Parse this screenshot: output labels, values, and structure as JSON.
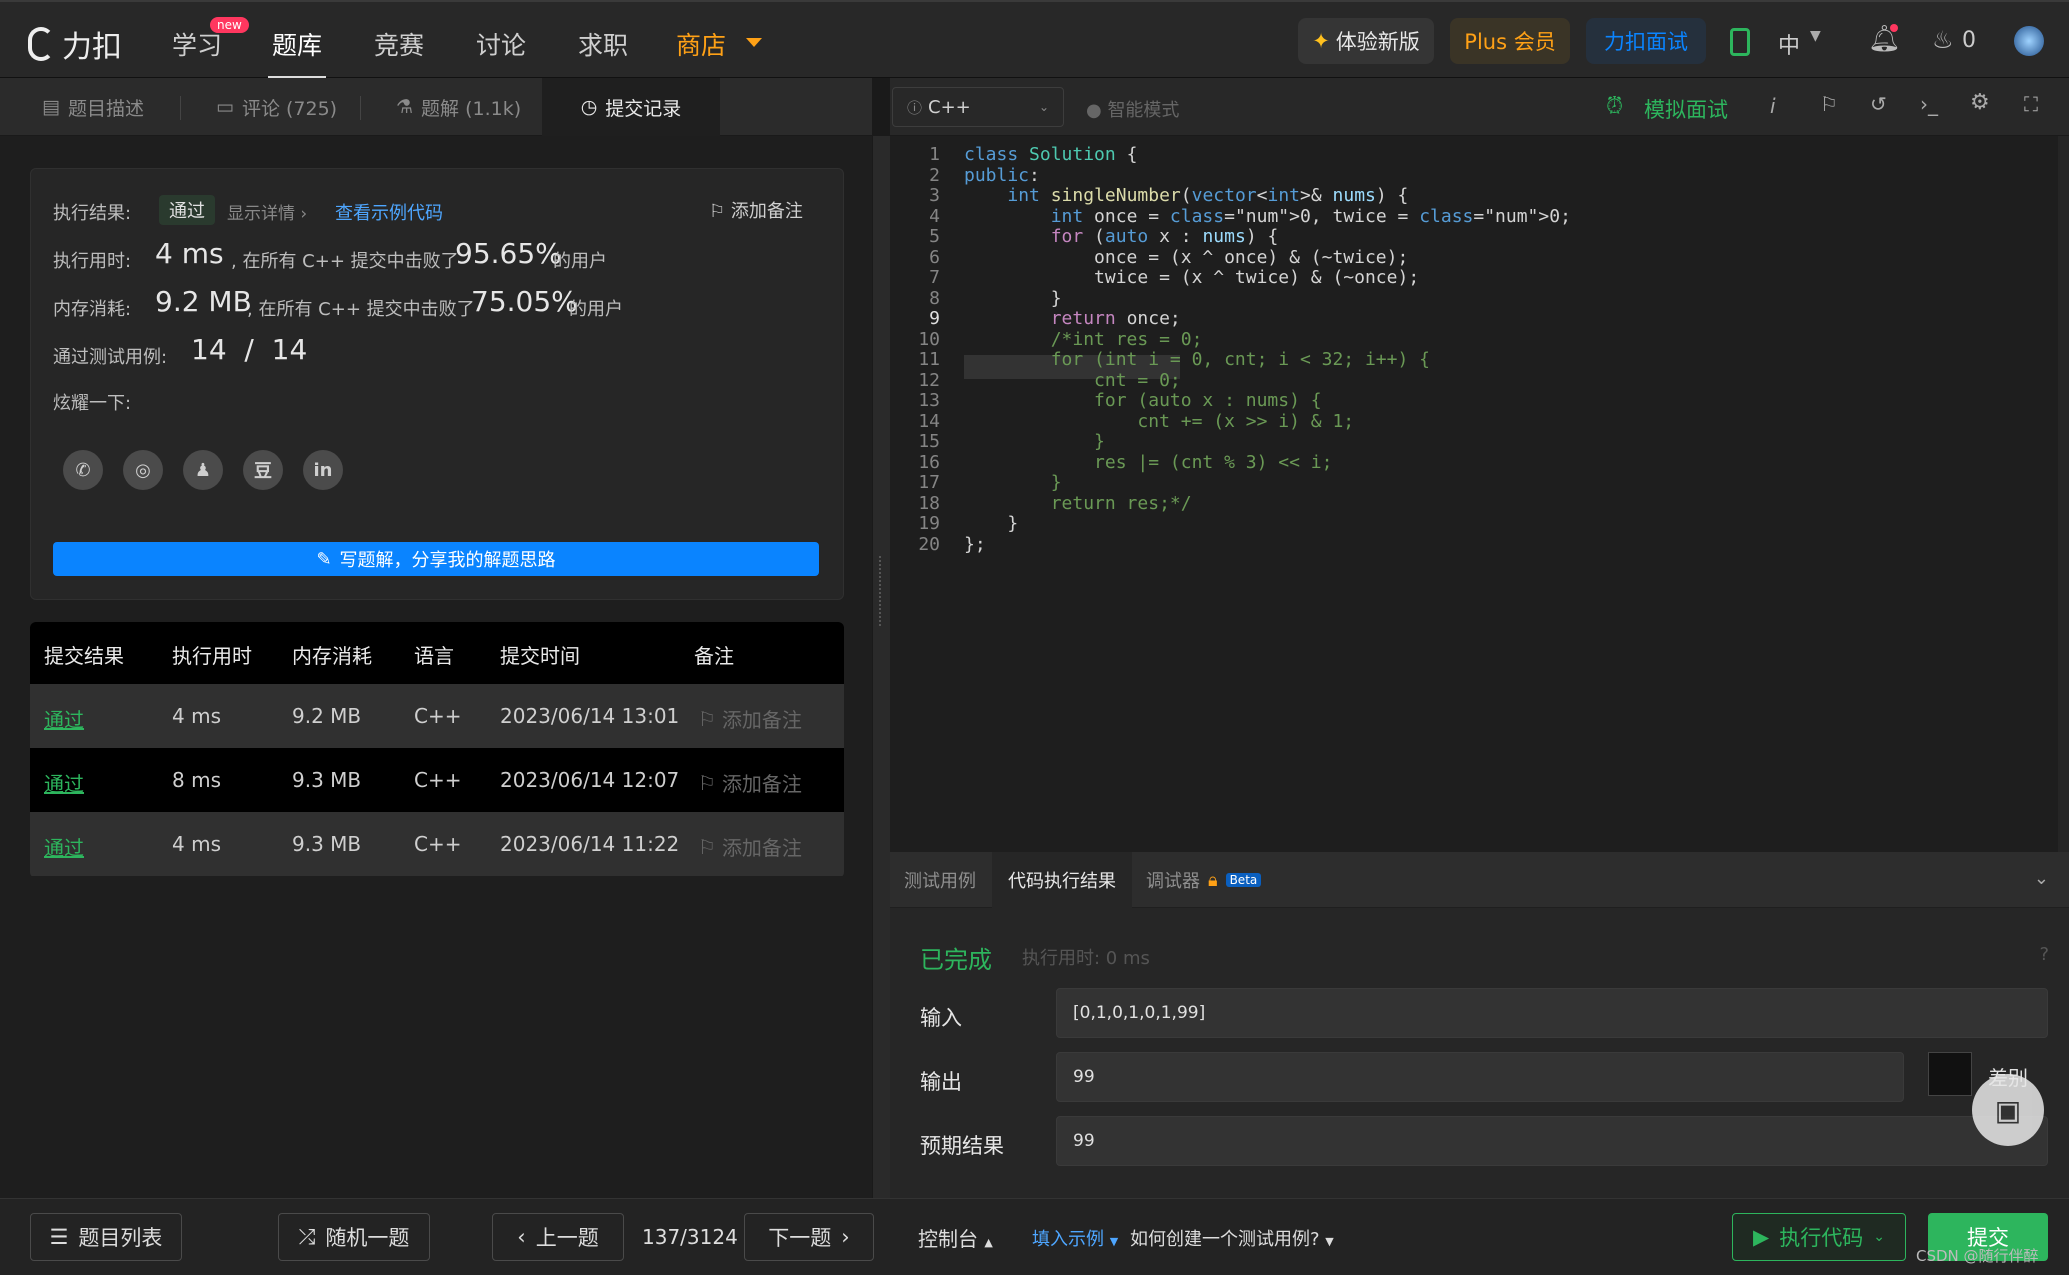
{
  "nav": {
    "logo": "力扣",
    "items": [
      "学习",
      "题库",
      "竞赛",
      "讨论",
      "求职",
      "商店"
    ],
    "new_badge": "new",
    "try_new": "体验新版",
    "plus": "Plus 会员",
    "interview": "力扣面试",
    "lang": "中",
    "fire_count": "0",
    "colors": {
      "shop": "#ffa116",
      "plus": "#ffa116",
      "interview": "#0a84ff",
      "badge": "#ff375f"
    }
  },
  "left_tabs": [
    "题目描述",
    "评论 (725)",
    "题解 (1.1k)",
    "提交记录"
  ],
  "editor_bar": {
    "language": "C++",
    "smart_mode": "智能模式",
    "mock": "模拟面试"
  },
  "result": {
    "label_result": "执行结果:",
    "status": "通过",
    "show_detail": "显示详情 ›",
    "sample_code": "查看示例代码",
    "add_note": "添加备注",
    "label_time": "执行用时:",
    "time_value": "4 ms",
    "beat_prefix": ", 在所有 C++ 提交中击败了",
    "time_pct": "95.65%",
    "users": "的用户",
    "label_mem": "内存消耗:",
    "mem_value": "9.2 MB",
    "mem_pct": "75.05%",
    "label_cases": "通过测试用例:",
    "cases": "14  /  14",
    "show_off": "炫耀一下:",
    "share_icons": [
      "wechat-icon",
      "weibo-icon",
      "qq-icon",
      "douban-icon",
      "linkedin-icon"
    ],
    "share_glyphs": [
      "✆",
      "◎",
      "♟",
      "豆",
      "in"
    ],
    "write_solution": "写题解，分享我的解题思路"
  },
  "submissions": {
    "headers": [
      "提交结果",
      "执行用时",
      "内存消耗",
      "语言",
      "提交时间",
      "备注"
    ],
    "rows": [
      {
        "status": "通过",
        "time": "4 ms",
        "mem": "9.2 MB",
        "lang": "C++",
        "date": "2023/06/14 13:01",
        "note": "添加备注"
      },
      {
        "status": "通过",
        "time": "8 ms",
        "mem": "9.3 MB",
        "lang": "C++",
        "date": "2023/06/14 12:07",
        "note": "添加备注"
      },
      {
        "status": "通过",
        "time": "4 ms",
        "mem": "9.3 MB",
        "lang": "C++",
        "date": "2023/06/14 11:22",
        "note": "添加备注"
      }
    ]
  },
  "code_lines": [
    "class Solution {",
    "public:",
    "    int singleNumber(vector<int>& nums) {",
    "        int once = 0, twice = 0;",
    "        for (auto x : nums) {",
    "            once = (x ^ once) & (~twice);",
    "            twice = (x ^ twice) & (~once);",
    "        }",
    "        return once;",
    "        /*int res = 0;",
    "        for (int i = 0, cnt; i < 32; i++) {",
    "            cnt = 0;",
    "            for (auto x : nums) {",
    "                cnt += (x >> i) & 1;",
    "            }",
    "            res |= (cnt % 3) << i;",
    "        }",
    "        return res;*/",
    "    }",
    "};"
  ],
  "console": {
    "tabs": [
      "测试用例",
      "代码执行结果",
      "调试器"
    ],
    "beta": "Beta",
    "done": "已完成",
    "exec_time": "执行用时: 0 ms",
    "input_label": "输入",
    "input_value": "[0,1,0,1,0,1,99]",
    "output_label": "输出",
    "output_value": "99",
    "diff": "差别",
    "expected_label": "预期结果",
    "expected_value": "99"
  },
  "footer": {
    "problem_list": "题目列表",
    "random": "随机一题",
    "prev": "上一题",
    "page": "137/3124",
    "next": "下一题",
    "console": "控制台",
    "fill_example": "填入示例",
    "how_create": "如何创建一个测试用例?",
    "run": "执行代码",
    "submit": "提交",
    "watermark": "CSDN @随行伴醉"
  }
}
